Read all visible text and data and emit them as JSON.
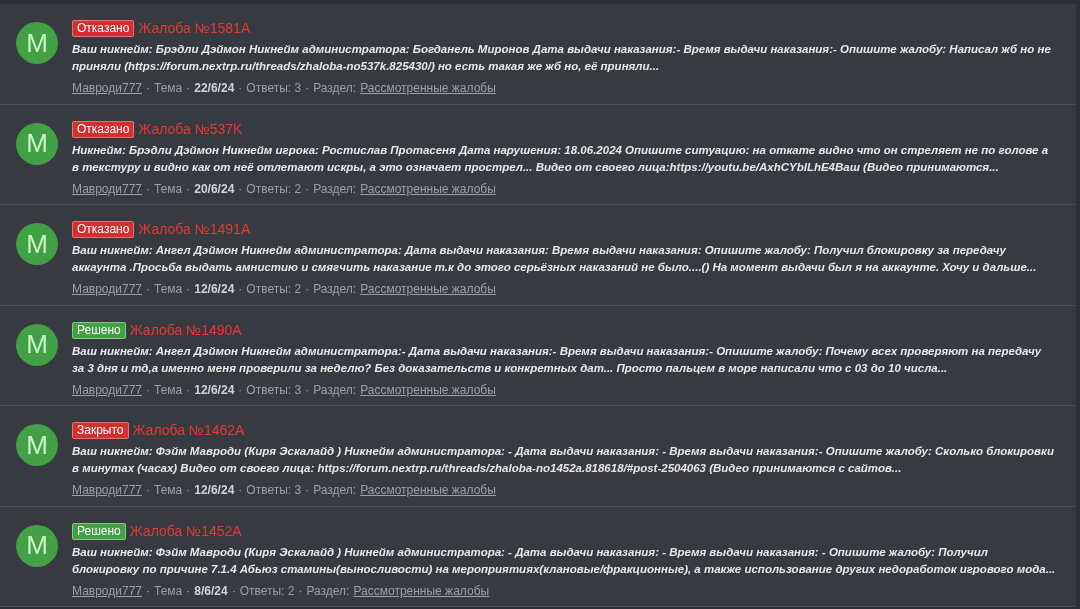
{
  "separator": "·",
  "threads": [
    {
      "avatar": "M",
      "status": {
        "kind": "rejected",
        "label": "Отказано"
      },
      "title": "Жалоба №1581А",
      "snippet": "Ваш никнейм: Брэдли Дэймон Никнейм администратора: Богданель Миронов Дата выдачи наказания:- Время выдачи наказания:- Опишите жалобу: Написал жб но не приняли (https://forum.nextrp.ru/threads/zhaloba-no537k.825430/) но есть такая же жб но, её приняли...",
      "author": "Мавроди777",
      "type": "Тема",
      "date": "22/6/24",
      "replies": "Ответы: 3",
      "section_label": "Раздел:",
      "section": "Рассмотренные жалобы"
    },
    {
      "avatar": "M",
      "status": {
        "kind": "rejected",
        "label": "Отказано"
      },
      "title": "Жалоба №537K",
      "snippet": "Никнейм: Брэдли Дэймон Никнейм игрока: Ростислав Протасеня Дата нарушения: 18.06.2024 Опишите ситуацию: на откате видно что он стреляет не по голове а в текстуру и видно как от неё отлетают искры, а это означает прострел... Видео от своего лица:https://youtu.be/AxhCYblLhE4Ваш (Видео принимаются...",
      "author": "Мавроди777",
      "type": "Тема",
      "date": "20/6/24",
      "replies": "Ответы: 2",
      "section_label": "Раздел:",
      "section": "Рассмотренные жалобы"
    },
    {
      "avatar": "M",
      "status": {
        "kind": "rejected",
        "label": "Отказано"
      },
      "title": "Жалоба №1491А",
      "snippet": "Ваш никнейм: Ангел Дэймон Никнейм администратора: Дата выдачи наказания: Время выдачи наказания: Опишите жалобу: Получил блокировку за передачу аккаунта .Просьба выдать амнистию и смягчить наказание т.к до этого серьёзных наказаний не было....() На момент выдачи был я на аккаунте. Хочу и дальше...",
      "author": "Мавроди777",
      "type": "Тема",
      "date": "12/6/24",
      "replies": "Ответы: 2",
      "section_label": "Раздел:",
      "section": "Рассмотренные жалобы"
    },
    {
      "avatar": "M",
      "status": {
        "kind": "solved",
        "label": "Решено"
      },
      "title": "Жалоба №1490А",
      "snippet": "Ваш никнейм: Ангел Дэймон Никнейм администратора:- Дата выдачи наказания:- Время выдачи наказания:- Опишите жалобу: Почему всех проверяют на передачу за 3 дня и тд,а именно меня проверили за неделю? Без доказательств и конкретных дат... Просто пальцем в море написали что с 03 до 10 числа...",
      "author": "Мавроди777",
      "type": "Тема",
      "date": "12/6/24",
      "replies": "Ответы: 3",
      "section_label": "Раздел:",
      "section": "Рассмотренные жалобы"
    },
    {
      "avatar": "M",
      "status": {
        "kind": "closed",
        "label": "Закрыто"
      },
      "title": "Жалоба №1462А",
      "snippet": "Ваш никнейм: Фэйм Мавроди (Киря Эскалайд ) Никнейм администратора: - Дата выдачи наказания: - Время выдачи наказания:- Опишите жалобу: Сколько блокировки в минутах (часах) Видео от своего лица: https://forum.nextrp.ru/threads/zhaloba-no1452a.818618/#post-2504063 (Видео принимаются с сайтов...",
      "author": "Мавроди777",
      "type": "Тема",
      "date": "12/6/24",
      "replies": "Ответы: 3",
      "section_label": "Раздел:",
      "section": "Рассмотренные жалобы"
    },
    {
      "avatar": "M",
      "status": {
        "kind": "solved",
        "label": "Решено"
      },
      "title": "Жалоба №1452А",
      "snippet": "Ваш никнейм: Фэйм Мавроди (Киря Эскалайд ) Никнейм администратора: - Дата выдачи наказания: - Время выдачи наказания: - Опишите жалобу: Получил блокировку по причине 7.1.4 Абьюз стамины(выносливости) на мероприятиях(клановые/фракционные), а также использование других недоработок игрового мода...",
      "author": "Мавроди777",
      "type": "Тема",
      "date": "8/6/24",
      "replies": "Ответы: 2",
      "section_label": "Раздел:",
      "section": "Рассмотренные жалобы"
    }
  ]
}
